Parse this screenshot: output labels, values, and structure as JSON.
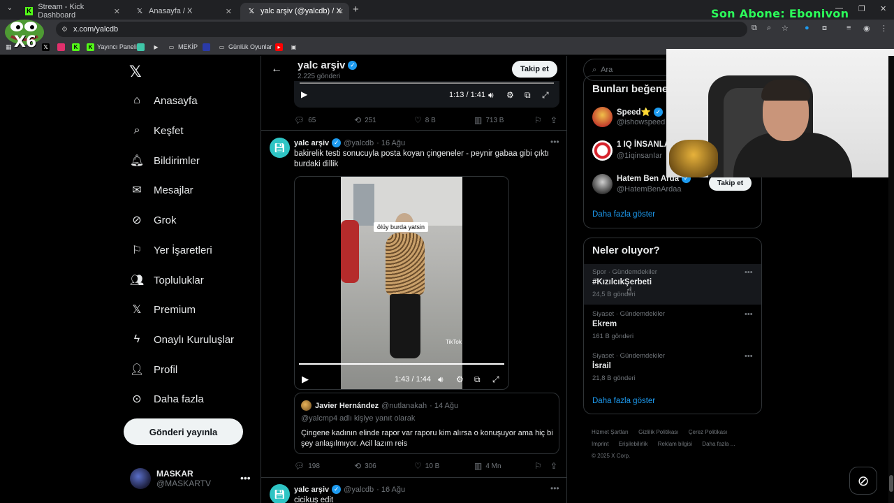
{
  "browser": {
    "tabs": [
      {
        "title": "Stream - Kick Dashboard",
        "icon": "kick-icon",
        "active": false
      },
      {
        "title": "Anasayfa / X",
        "icon": "x-icon",
        "active": false
      },
      {
        "title": "yalc arşiv (@yalcdb) / X",
        "icon": "x-icon",
        "active": true
      }
    ],
    "url": "x.com/yalcdb",
    "bookmarks": [
      "Yayıncı Paneli",
      "MEKİP",
      "Günlük Oyunlar"
    ],
    "overlay_banner": "Son Abone: Ebonivon",
    "overlay_badge": "X6"
  },
  "nav": {
    "items": [
      {
        "label": "Anasayfa",
        "icon": "home-icon"
      },
      {
        "label": "Keşfet",
        "icon": "search-icon"
      },
      {
        "label": "Bildirimler",
        "icon": "bell-icon"
      },
      {
        "label": "Mesajlar",
        "icon": "mail-icon"
      },
      {
        "label": "Grok",
        "icon": "grok-icon"
      },
      {
        "label": "Yer İşaretleri",
        "icon": "bookmark-icon"
      },
      {
        "label": "Topluluklar",
        "icon": "communities-icon"
      },
      {
        "label": "Premium",
        "icon": "x-icon"
      },
      {
        "label": "Onaylı Kuruluşlar",
        "icon": "lightning-icon"
      },
      {
        "label": "Profil",
        "icon": "person-icon"
      },
      {
        "label": "Daha fazla",
        "icon": "more-circle-icon"
      }
    ],
    "post_button": "Gönderi yayınla",
    "account": {
      "name": "MASKAR",
      "handle": "@MASKARTV"
    }
  },
  "profile_header": {
    "name": "yalc arşiv",
    "post_count": "2.225 gönderi",
    "follow_label": "Takip et"
  },
  "tweet1": {
    "video_time": "1:13 / 1:41",
    "replies": "65",
    "retweets": "251",
    "likes": "8 B",
    "views": "713 B"
  },
  "tweet2": {
    "name": "yalc arşiv",
    "handle": "@yalcdb",
    "date": "· 16 Ağu",
    "text": "bakirelik testi sonucuyla posta koyan çingeneler - peynir gabaa gibi çıktı burdaki dillik",
    "video_caption": "ölüy burda yatsin",
    "video_watermark": "TikTok",
    "video_time": "1:43 / 1:44",
    "quote": {
      "name": "Javier Hernández",
      "handle": "@nutlanakah",
      "date": "· 14 Ağu",
      "reply_to": "@yalcmp4 adlı kişiye yanıt olarak",
      "text": "Çingene kadının elinde rapor var raporu kim alırsa o konuşuyor ama hiç bi şey anlaşılmıyor.  Acil lazım reis"
    },
    "replies": "198",
    "retweets": "306",
    "likes": "10 B",
    "views": "4 Mn"
  },
  "tweet3": {
    "name": "yalc arşiv",
    "handle": "@yalcdb",
    "date": "· 16 Ağu",
    "text": "cicikuş edit"
  },
  "sidebar": {
    "search_placeholder": "Ara",
    "who_to_follow_title": "Bunları beğene",
    "who": [
      {
        "name": "Speed⭐",
        "handle": "@ishowspeed"
      },
      {
        "name": "1 IQ İNSANLA",
        "handle": "@1iqinsanIar"
      },
      {
        "name": "Hatem Ben Arda",
        "handle": "@HatemBenArdaa",
        "button": "Takip et"
      }
    ],
    "show_more": "Daha fazla göster",
    "trends_title": "Neler oluyor?",
    "trends": [
      {
        "context": "Spor · Gündemdekiler",
        "name": "#KızılcıkŞerbeti",
        "posts": "24,5 B gönderi"
      },
      {
        "context": "Siyaset · Gündemdekiler",
        "name": "Ekrem",
        "posts": "161 B gönderi"
      },
      {
        "context": "Siyaset · Gündemdekiler",
        "name": "İsrail",
        "posts": "21,8 B gönderi"
      }
    ],
    "trends_show_more": "Daha fazla göster",
    "footer": [
      "Hizmet Şartları",
      "Gizlilik Politikası",
      "Çerez Politikası",
      "Imprint",
      "Erişilebilirlik",
      "Reklam bilgisi",
      "Daha fazla ...",
      "© 2025 X Corp."
    ]
  }
}
